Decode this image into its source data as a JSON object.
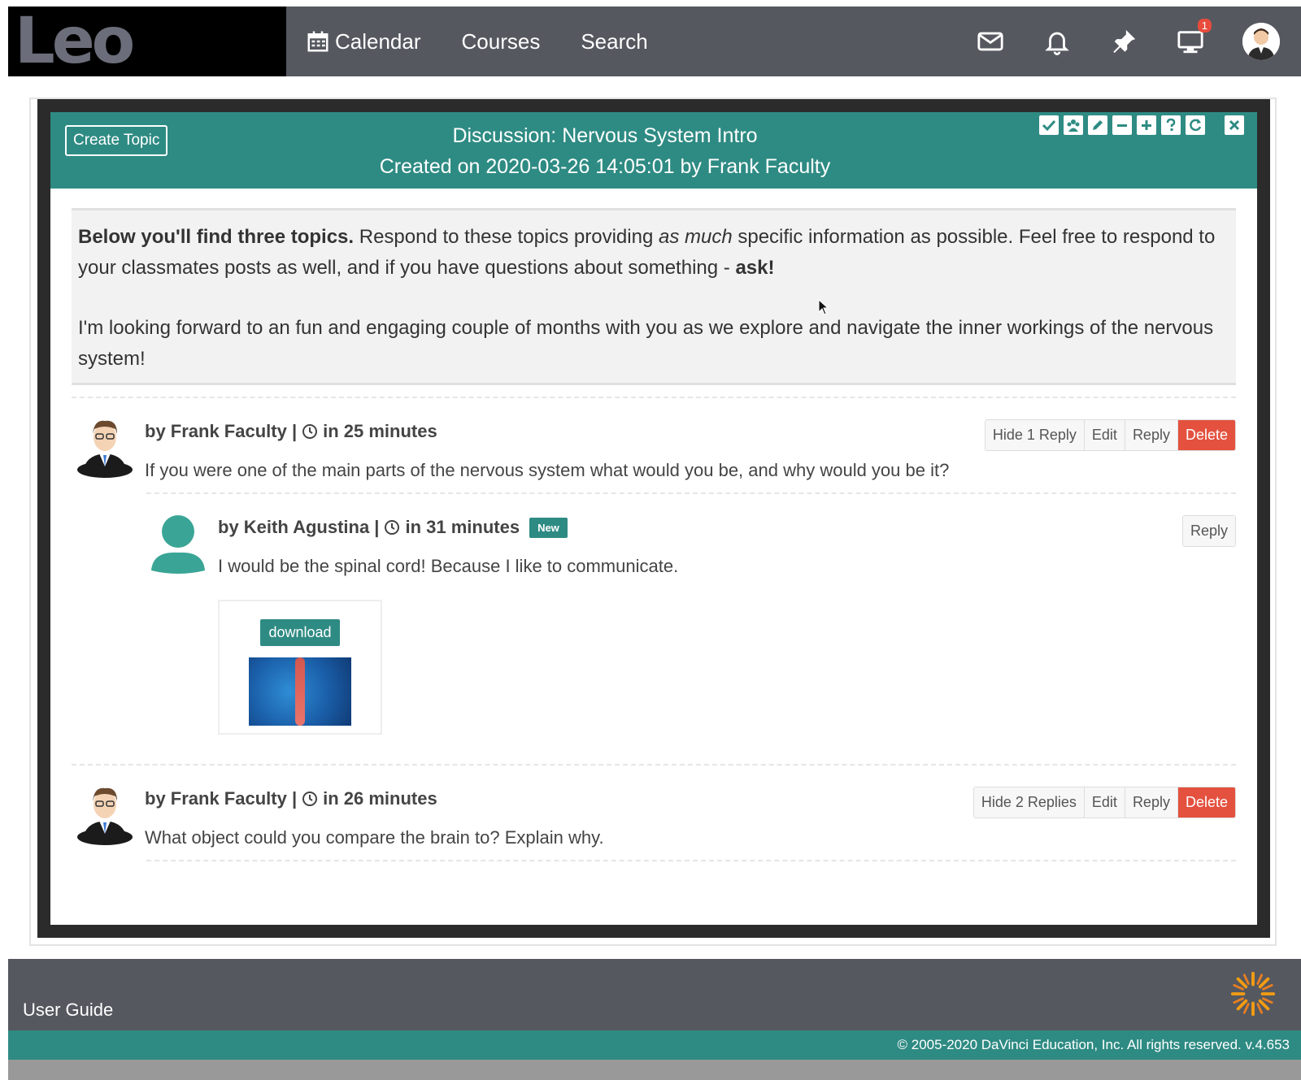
{
  "nav": {
    "logo": "Leo",
    "links": [
      {
        "label": "Calendar"
      },
      {
        "label": "Courses"
      },
      {
        "label": "Search"
      }
    ],
    "monitor_badge": "1"
  },
  "modal": {
    "create_topic_label": "Create Topic",
    "title_line1": "Discussion: Nervous System Intro",
    "title_line2": "Created on 2020-03-26 14:05:01 by Frank Faculty",
    "intro": {
      "bold_lead": "Below you'll find three topics.",
      "text_a": " Respond to these topics providing ",
      "italic": "as much",
      "text_b": " specific information as possible. Feel free to respond to your classmates posts as well, and if you have questions about something - ",
      "bold_end": "ask!",
      "para2": "I'm looking forward to an fun and engaging couple of months with you as we explore and navigate the inner workings of the nervous system!"
    },
    "posts": [
      {
        "author": "by Frank Faculty |",
        "time": "in 25 minutes",
        "text": "If you were one of the main parts of the nervous system what would you be, and why would you be it?",
        "buttons": {
          "hide": "Hide 1 Reply",
          "edit": "Edit",
          "reply": "Reply",
          "delete": "Delete"
        }
      },
      {
        "author": "by Frank Faculty |",
        "time": "in 26 minutes",
        "text": "What object could you compare the brain to? Explain why.",
        "buttons": {
          "hide": "Hide 2 Replies",
          "edit": "Edit",
          "reply": "Reply",
          "delete": "Delete"
        }
      }
    ],
    "reply": {
      "author": "by Keith Agustina |",
      "time": "in 31 minutes",
      "badge": "New",
      "text": "I would be the spinal cord! Because I like to communicate.",
      "reply_label": "Reply",
      "download_label": "download"
    }
  },
  "footer": {
    "user_guide": "User Guide",
    "copyright": "© 2005-2020 DaVinci Education, Inc. All rights reserved. v.4.653"
  },
  "colors": {
    "teal": "#2e8b83",
    "nav_gray": "#55585f",
    "delete_red": "#e4513f"
  }
}
